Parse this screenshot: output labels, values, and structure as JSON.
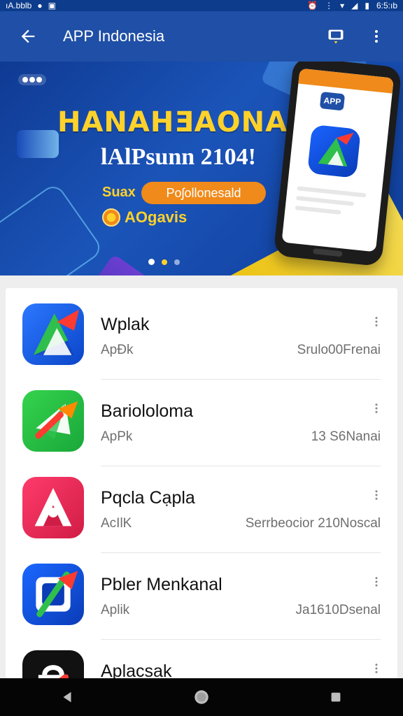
{
  "status": {
    "left_text": "ıA.bblb",
    "right_text": "6:5:ıb"
  },
  "appbar": {
    "title": "APP Indonesia"
  },
  "banner": {
    "headline": "HANAHƎAONAU",
    "subline": "lAlPsunn 2104!",
    "promo_left": "Suax",
    "promo_pill": "Poʃollonesald",
    "badge_text": "AOgavis",
    "phone_logo": "APP",
    "carousel": {
      "count": 3,
      "active_index": 0
    }
  },
  "list": {
    "items": [
      {
        "name": "Wplak",
        "type": "ApĐk",
        "meta": "Srulo00Frenai",
        "icon": "a-logo-icon"
      },
      {
        "name": "Bariololoma",
        "type": "ApPk",
        "meta": "13 S6Nanai",
        "icon": "paper-plane-icon"
      },
      {
        "name": "Pqcla Cạpla",
        "type": "AcIlK",
        "meta": "Serrbeocior 210Noscal",
        "icon": "red-home-icon"
      },
      {
        "name": "Pbler Menkanal",
        "type": "Aplik",
        "meta": "Ja1610Dsenal",
        "icon": "blue-b-icon"
      },
      {
        "name": "Aplacsak",
        "type": "",
        "meta": "",
        "icon": "bag-icon"
      }
    ]
  },
  "colors": {
    "status_bar": "#0d3c8c",
    "appbar": "#1f4fa6",
    "accent_orange": "#f08a1a",
    "accent_yellow": "#ffd22b"
  }
}
